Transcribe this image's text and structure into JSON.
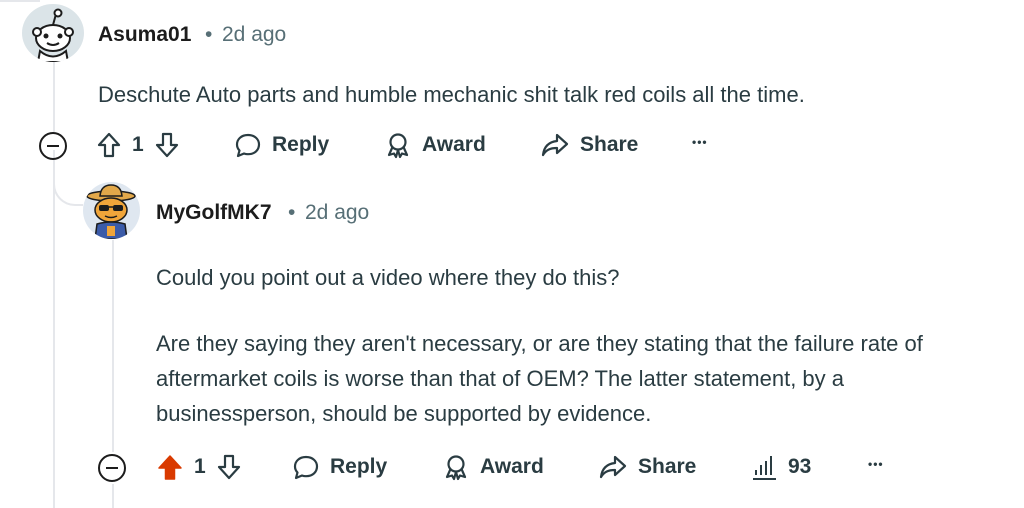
{
  "comments": [
    {
      "username": "Asuma01",
      "separator": "•",
      "time": "2d ago",
      "body": [
        "Deschute Auto parts and humble mechanic shit talk red coils all the time."
      ],
      "score": "1",
      "actions": {
        "reply": "Reply",
        "award": "Award",
        "share": "Share",
        "more": "•••"
      },
      "vote_state": "none"
    },
    {
      "username": "MyGolfMK7",
      "separator": "•",
      "time": "2d ago",
      "body": [
        "Could you point out a video where they do this?",
        "Are they saying they aren't necessary, or are they stating that the failure rate of aftermarket coils is worse than that of OEM? The latter statement, by a businessperson, should be supported by evidence."
      ],
      "score": "1",
      "actions": {
        "reply": "Reply",
        "award": "Award",
        "share": "Share",
        "insights": "93",
        "more": "•••"
      },
      "vote_state": "upvoted"
    }
  ],
  "colors": {
    "upvote": "#d93a00",
    "text": "#2a3c42",
    "meta": "#576f76",
    "thread": "#e5e7eb"
  }
}
